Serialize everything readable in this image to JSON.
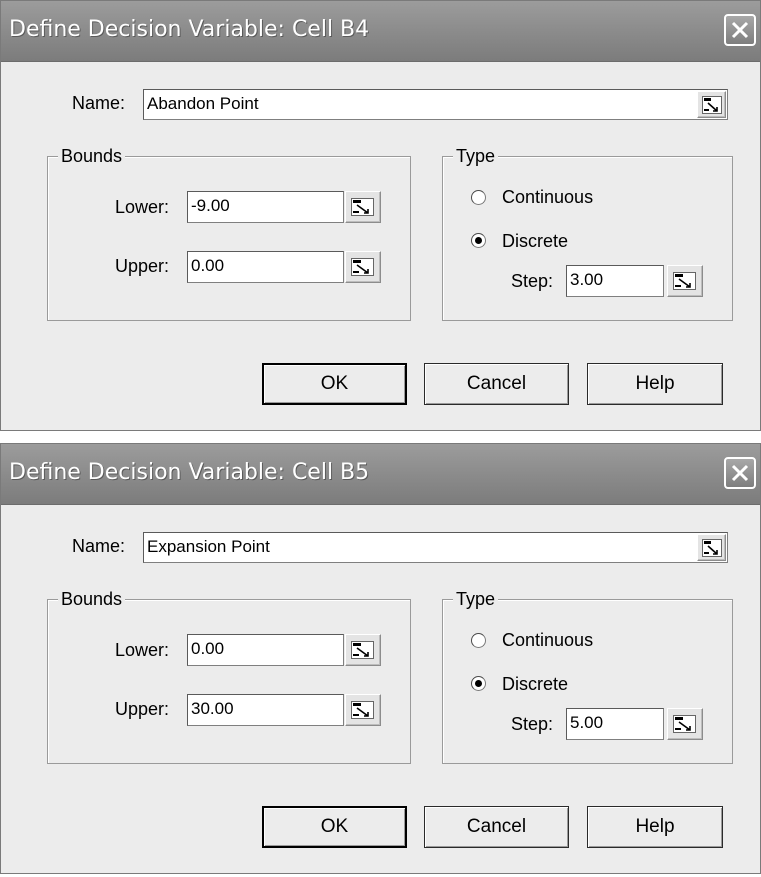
{
  "dialogs": [
    {
      "title": "Define Decision Variable: Cell B4",
      "name_label": "Name:",
      "name_value": "Abandon Point",
      "bounds_label": "Bounds",
      "lower_label": "Lower:",
      "lower_value": "-9.00",
      "upper_label": "Upper:",
      "upper_value": "0.00",
      "type_label": "Type",
      "continuous_label": "Continuous",
      "discrete_label": "Discrete",
      "selected_type": "Discrete",
      "step_label": "Step:",
      "step_value": "3.00",
      "ok_label": "OK",
      "cancel_label": "Cancel",
      "help_label": "Help"
    },
    {
      "title": "Define Decision Variable: Cell B5",
      "name_label": "Name:",
      "name_value": "Expansion Point",
      "bounds_label": "Bounds",
      "lower_label": "Lower:",
      "lower_value": "0.00",
      "upper_label": "Upper:",
      "upper_value": "30.00",
      "type_label": "Type",
      "continuous_label": "Continuous",
      "discrete_label": "Discrete",
      "selected_type": "Discrete",
      "step_label": "Step:",
      "step_value": "5.00",
      "ok_label": "OK",
      "cancel_label": "Cancel",
      "help_label": "Help"
    }
  ],
  "icons": {
    "close": "close-icon",
    "cell_reference": "cell-reference-icon"
  },
  "colors": {
    "titlebar": "#8a8a8a",
    "dialog_background": "#ececec",
    "title_text": "#ffffff"
  }
}
